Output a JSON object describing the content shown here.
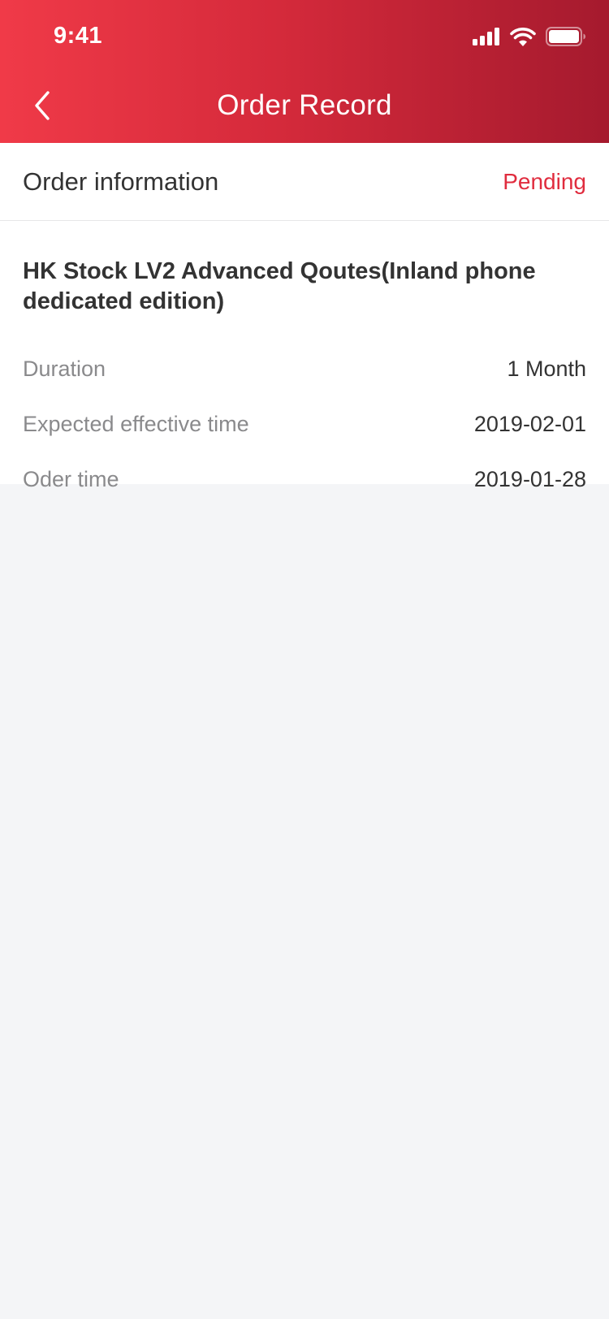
{
  "status_bar": {
    "time": "9:41",
    "icons": [
      "cellular-signal-icon",
      "wifi-icon",
      "battery-icon"
    ]
  },
  "nav": {
    "back_icon": "chevron-left-icon",
    "title": "Order Record"
  },
  "order_info": {
    "title": "Order information",
    "status": "Pending",
    "status_color": "#e02c3e"
  },
  "product": {
    "name": "HK Stock LV2 Advanced Qoutes(Inland phone dedicated edition)"
  },
  "details": [
    {
      "label": "Duration",
      "value": "1 Month"
    },
    {
      "label": "Expected effective time",
      "value": "2019-02-01"
    },
    {
      "label": "Oder time",
      "value": "2019-01-28"
    }
  ],
  "colors": {
    "header_gradient_start": "#f03a48",
    "header_gradient_end": "#a51a2e",
    "page_background": "#f4f5f7"
  }
}
